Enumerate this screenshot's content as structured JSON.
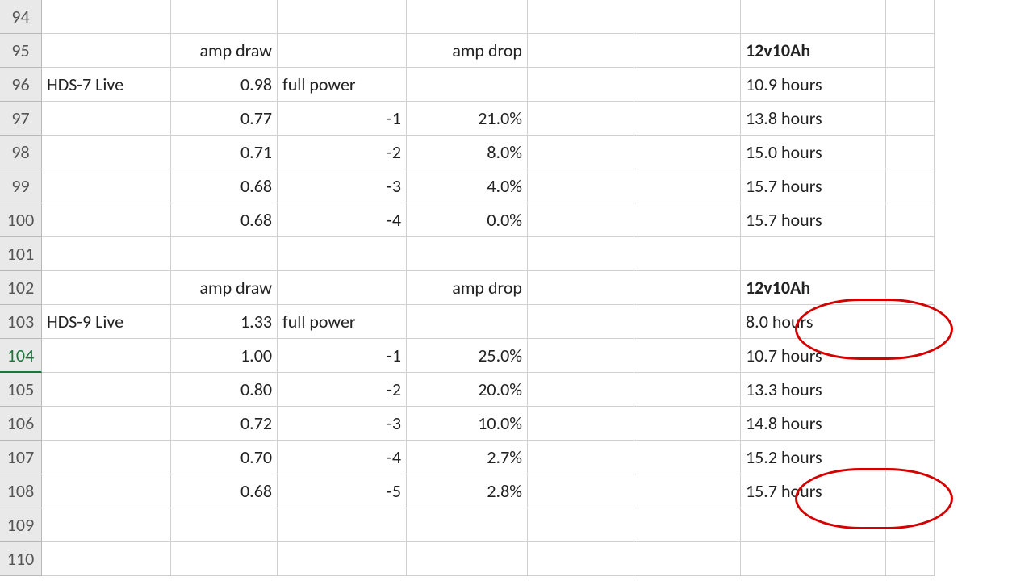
{
  "active_row_label": "104",
  "rownums": [
    "94",
    "95",
    "96",
    "97",
    "98",
    "99",
    "100",
    "101",
    "102",
    "103",
    "104",
    "105",
    "106",
    "107",
    "108",
    "109",
    "110"
  ],
  "rows": [
    {
      "A": "",
      "B": "",
      "C": "",
      "D": "",
      "E": "",
      "F": "",
      "G": ""
    },
    {
      "A": "",
      "B": "amp draw",
      "C": "",
      "D": "amp drop",
      "E": "",
      "F": "",
      "G": "12v10Ah",
      "Gb": true
    },
    {
      "A": "HDS-7 Live",
      "B": "0.98",
      "C": "full power",
      "D": "",
      "E": "",
      "F": "",
      "G": "10.9 hours"
    },
    {
      "A": "",
      "B": "0.77",
      "C": "-1",
      "D": "21.0%",
      "E": "",
      "F": "",
      "G": "13.8 hours"
    },
    {
      "A": "",
      "B": "0.71",
      "C": "-2",
      "D": "8.0%",
      "E": "",
      "F": "",
      "G": "15.0 hours"
    },
    {
      "A": "",
      "B": "0.68",
      "C": "-3",
      "D": "4.0%",
      "E": "",
      "F": "",
      "G": "15.7 hours"
    },
    {
      "A": "",
      "B": "0.68",
      "C": "-4",
      "D": "0.0%",
      "E": "",
      "F": "",
      "G": "15.7 hours"
    },
    {
      "A": "",
      "B": "",
      "C": "",
      "D": "",
      "E": "",
      "F": "",
      "G": ""
    },
    {
      "A": "",
      "B": "amp draw",
      "C": "",
      "D": "amp drop",
      "E": "",
      "F": "",
      "G": "12v10Ah",
      "Gb": true
    },
    {
      "A": "HDS-9 Live",
      "B": "1.33",
      "C": "full power",
      "D": "",
      "E": "",
      "F": "",
      "G": "8.0 hours"
    },
    {
      "A": "",
      "B": "1.00",
      "C": "-1",
      "D": "25.0%",
      "E": "",
      "F": "",
      "G": "10.7 hours"
    },
    {
      "A": "",
      "B": "0.80",
      "C": "-2",
      "D": "20.0%",
      "E": "",
      "F": "",
      "G": "13.3 hours"
    },
    {
      "A": "",
      "B": "0.72",
      "C": "-3",
      "D": "10.0%",
      "E": "",
      "F": "",
      "G": "14.8 hours"
    },
    {
      "A": "",
      "B": "0.70",
      "C": "-4",
      "D": "2.7%",
      "E": "",
      "F": "",
      "G": "15.2 hours"
    },
    {
      "A": "",
      "B": "0.68",
      "C": "-5",
      "D": "2.8%",
      "E": "",
      "F": "",
      "G": "15.7 hours"
    },
    {
      "A": "",
      "B": "",
      "C": "",
      "D": "",
      "E": "",
      "F": "",
      "G": ""
    },
    {
      "A": "",
      "B": "",
      "C": "",
      "D": "",
      "E": "",
      "F": "",
      "G": ""
    }
  ],
  "col_align": {
    "A": "l",
    "B": "r",
    "C": "l",
    "D": "r",
    "E": "l",
    "F": "l",
    "G": "l"
  },
  "col_align_override": {
    "C_numeric": "r"
  }
}
